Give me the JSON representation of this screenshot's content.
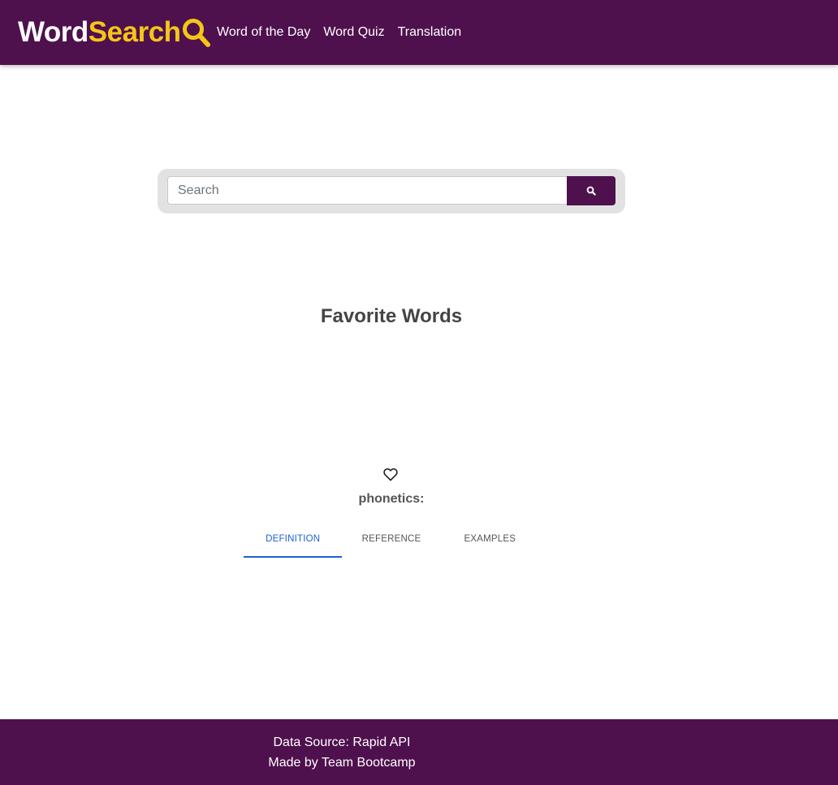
{
  "navbar": {
    "brand_part1": "Word",
    "brand_part2": "Search",
    "brand_icon": "magnifier-icon",
    "links": [
      "Word of the Day",
      "Word Quiz",
      "Translation"
    ],
    "colors": {
      "background": "#4e114d",
      "accent": "#f5c518"
    }
  },
  "search": {
    "placeholder": "Search",
    "value": "",
    "button_icon": "search-icon"
  },
  "favorites": {
    "title": "Favorite Words"
  },
  "word_card": {
    "favorite_icon": "heart-outline-icon",
    "phonetics_label": "phonetics:",
    "tabs": [
      "DEFINITION",
      "REFERENCE",
      "EXAMPLES"
    ],
    "active_tab": "DEFINITION",
    "active_color": "#1f5fd1"
  },
  "footer": {
    "line1": "Data Source: Rapid API",
    "line2": "Made by Team Bootcamp"
  }
}
